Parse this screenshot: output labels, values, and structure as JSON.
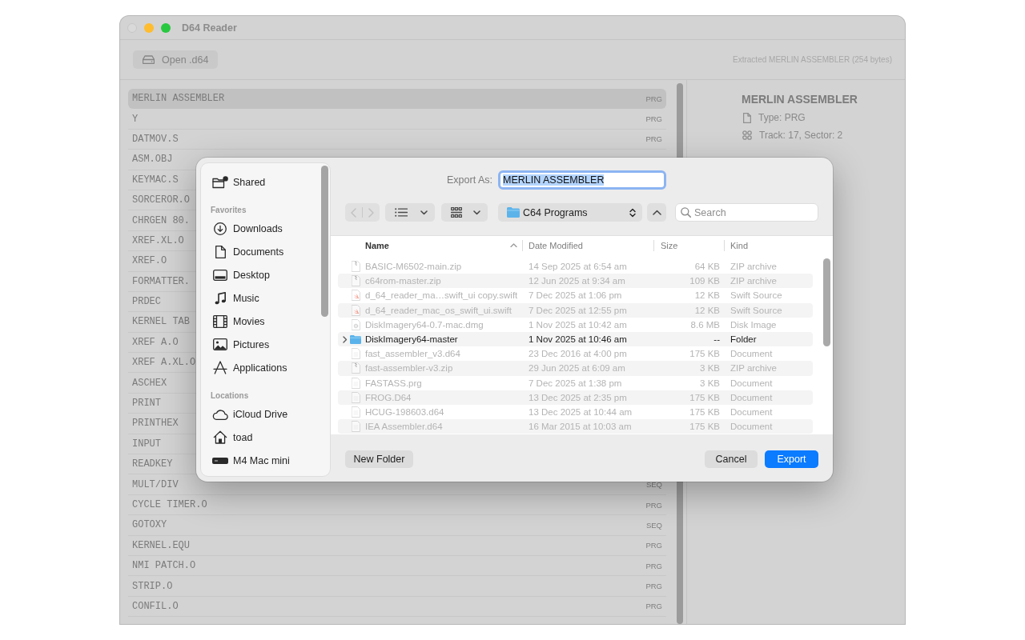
{
  "window": {
    "title": "D64 Reader",
    "controls": [
      {
        "kind": "close",
        "disabled": true
      },
      {
        "kind": "minimize",
        "disabled": false
      },
      {
        "kind": "zoom",
        "disabled": false
      }
    ]
  },
  "toolbar": {
    "open_button": "Open .d64",
    "status": "Extracted MERLIN ASSEMBLER (254 bytes)"
  },
  "disk_list": [
    {
      "name": "MERLIN ASSEMBLER",
      "type": "PRG",
      "selected": true
    },
    {
      "name": "Y",
      "type": "PRG",
      "selected": false
    },
    {
      "name": "DATMOV.S",
      "type": "PRG",
      "selected": false
    },
    {
      "name": "ASM.OBJ",
      "selected": false
    },
    {
      "name": "KEYMAC.S",
      "selected": false
    },
    {
      "name": "SORCEROR.O",
      "selected": false
    },
    {
      "name": "CHRGEN 80.",
      "selected": false
    },
    {
      "name": "XREF.XL.O",
      "selected": false
    },
    {
      "name": "XREF.O",
      "selected": false
    },
    {
      "name": "FORMATTER.",
      "selected": false
    },
    {
      "name": "PRDEC",
      "selected": false
    },
    {
      "name": "KERNEL TAB",
      "selected": false
    },
    {
      "name": "XREF A.O",
      "selected": false
    },
    {
      "name": "XREF A.XL.O",
      "selected": false
    },
    {
      "name": "ASCHEX",
      "selected": false
    },
    {
      "name": "PRINT",
      "selected": false
    },
    {
      "name": "PRINTHEX",
      "selected": false
    },
    {
      "name": "INPUT",
      "selected": false
    },
    {
      "name": "READKEY",
      "selected": false
    },
    {
      "name": "MULT/DIV",
      "type": "SEQ",
      "selected": false
    },
    {
      "name": "CYCLE TIMER.O",
      "type": "PRG",
      "selected": false
    },
    {
      "name": "GOTOXY",
      "type": "SEQ",
      "selected": false
    },
    {
      "name": "KERNEL.EQU",
      "type": "PRG",
      "selected": false
    },
    {
      "name": "NMI PATCH.O",
      "type": "PRG",
      "selected": false
    },
    {
      "name": "STRIP.O",
      "type": "PRG",
      "selected": false
    },
    {
      "name": "CONFIL.O",
      "type": "PRG",
      "selected": false
    }
  ],
  "detail": {
    "title": "MERLIN ASSEMBLER",
    "type": "Type: PRG",
    "location": "Track: 17, Sector: 2"
  },
  "export_sheet": {
    "sidebar": [
      {
        "items": [
          {
            "kind": "shared",
            "label": "Shared",
            "selected": false
          }
        ]
      },
      {
        "heading": "Favorites",
        "items": [
          {
            "kind": "downloads",
            "label": "Downloads",
            "selected": false
          },
          {
            "kind": "documents",
            "label": "Documents",
            "selected": false
          },
          {
            "kind": "desktop",
            "label": "Desktop",
            "selected": false
          },
          {
            "kind": "music",
            "label": "Music",
            "selected": false
          },
          {
            "kind": "movies",
            "label": "Movies",
            "selected": false
          },
          {
            "kind": "pictures",
            "label": "Pictures",
            "selected": false
          },
          {
            "kind": "applications",
            "label": "Applications",
            "selected": false
          }
        ]
      },
      {
        "heading": "Locations",
        "items": [
          {
            "kind": "icloud",
            "label": "iCloud Drive",
            "selected": false
          },
          {
            "kind": "home",
            "label": "toad",
            "selected": false
          },
          {
            "kind": "computer",
            "label": "M4 Mac mini",
            "selected": false
          }
        ]
      }
    ],
    "export_as": {
      "label": "Export As:",
      "value": "MERLIN ASSEMBLER",
      "focused": true,
      "text_selected": true
    },
    "nav_buttons": [
      {
        "kind": "back",
        "disabled": true
      },
      {
        "kind": "forward",
        "disabled": true
      }
    ],
    "location": "C64 Programs",
    "search": {
      "placeholder": "Search"
    },
    "columns": [
      {
        "label": "Name",
        "sorted": true
      },
      {
        "label": "Date Modified",
        "sorted": false
      },
      {
        "label": "Size",
        "sorted": false
      },
      {
        "label": "Kind",
        "sorted": false
      }
    ],
    "files": [
      {
        "kind": "zip",
        "name": "BASIC-M6502-main.zip",
        "date": "14 Sep 2025 at 6:54 am",
        "size": "64 KB",
        "type": "ZIP archive",
        "disabled": true,
        "selected": false
      },
      {
        "kind": "zip",
        "name": "c64rom-master.zip",
        "date": "12 Jun 2025 at 9:34 am",
        "size": "109 KB",
        "type": "ZIP archive",
        "disabled": true,
        "selected": false
      },
      {
        "kind": "swift",
        "name": "d_64_reader_ma…swift_ui copy.swift",
        "date": "7 Dec 2025 at 1:06 pm",
        "size": "12 KB",
        "type": "Swift Source",
        "disabled": true,
        "selected": false
      },
      {
        "kind": "swift",
        "name": "d_64_reader_mac_os_swift_ui.swift",
        "date": "7 Dec 2025 at 12:55 pm",
        "size": "12 KB",
        "type": "Swift Source",
        "disabled": true,
        "selected": false
      },
      {
        "kind": "dmg",
        "name": "DiskImagery64-0.7-mac.dmg",
        "date": "1 Nov 2025 at 10:42 am",
        "size": "8.6 MB",
        "type": "Disk Image",
        "disabled": true,
        "selected": false
      },
      {
        "kind": "folder",
        "name": "DiskImagery64-master",
        "date": "1 Nov 2025 at 10:46 am",
        "size": "--",
        "type": "Folder",
        "disabled": false,
        "selected": false,
        "expanded": false
      },
      {
        "kind": "document",
        "name": "fast_assembler_v3.d64",
        "date": "23 Dec 2016 at 4:00 pm",
        "size": "175 KB",
        "type": "Document",
        "disabled": true,
        "selected": false
      },
      {
        "kind": "zip",
        "name": "fast-assembler-v3.zip",
        "date": "29 Jun 2025 at 6:09 am",
        "size": "3 KB",
        "type": "ZIP archive",
        "disabled": true,
        "selected": false
      },
      {
        "kind": "document",
        "name": "FASTASS.prg",
        "date": "7 Dec 2025 at 1:38 pm",
        "size": "3 KB",
        "type": "Document",
        "disabled": true,
        "selected": false
      },
      {
        "kind": "document",
        "name": "FROG.D64",
        "date": "13 Dec 2025 at 2:35 pm",
        "size": "175 KB",
        "type": "Document",
        "disabled": true,
        "selected": false
      },
      {
        "kind": "document",
        "name": "HCUG-198603.d64",
        "date": "13 Dec 2025 at 10:44 am",
        "size": "175 KB",
        "type": "Document",
        "disabled": true,
        "selected": false
      },
      {
        "kind": "document",
        "name": "IEA Assembler.d64",
        "date": "16 Mar 2015 at 10:03 am",
        "size": "175 KB",
        "type": "Document",
        "disabled": true,
        "selected": false
      }
    ],
    "new_folder_button": "New Folder",
    "buttons": [
      {
        "label": "Cancel",
        "default": false
      },
      {
        "label": "Export",
        "default": true
      }
    ]
  }
}
